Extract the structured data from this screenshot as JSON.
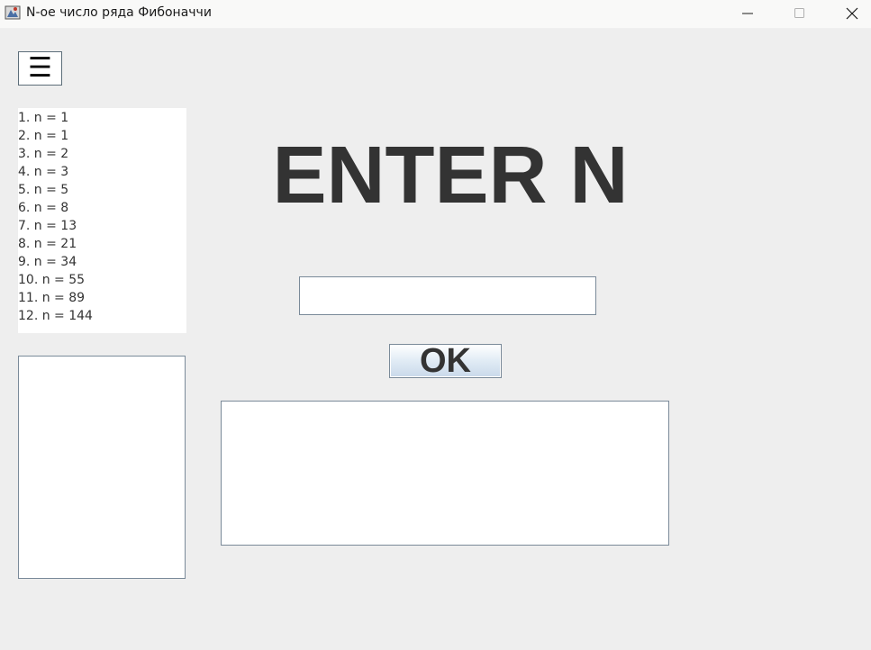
{
  "window": {
    "title": "N-ое число ряда Фибоначчи"
  },
  "menu": {
    "glyph": "☰"
  },
  "fib_list": {
    "items": [
      "1. n = 1",
      "2. n = 1",
      "3. n = 2",
      "4. n = 3",
      "5. n = 5",
      "6. n = 8",
      "7. n = 13",
      "8. n = 21",
      "9. n = 34",
      "10. n = 55",
      "11. n = 89",
      "12. n = 144"
    ]
  },
  "main": {
    "heading": "ENTER N",
    "input_value": "",
    "ok_label": "OK",
    "result_text": ""
  },
  "colors": {
    "background": "#eeeeee",
    "text": "#333333",
    "border": "#7a8a99"
  }
}
